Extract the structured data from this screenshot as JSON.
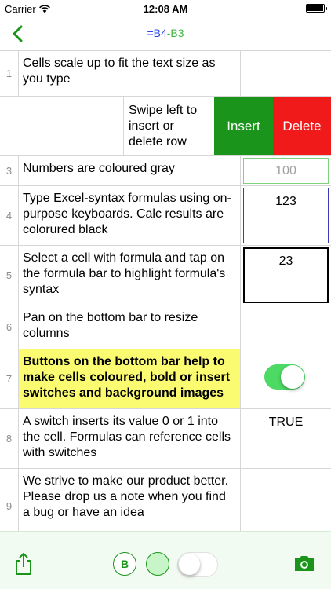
{
  "status_bar": {
    "carrier": "Carrier",
    "time": "12:08 AM"
  },
  "formula_bar": {
    "prefix": "=",
    "ref_a": "B4",
    "operator": "-",
    "ref_b": "B3"
  },
  "rows": {
    "r1": {
      "num": "1",
      "text": "Cells scale up to fit the text size as you type",
      "value": ""
    },
    "r2": {
      "text": "Swipe left to insert or delete row",
      "insert_label": "Insert",
      "delete_label": "Delete"
    },
    "r3": {
      "num": "3",
      "text": "Numbers are coloured gray",
      "value": "100"
    },
    "r4": {
      "num": "4",
      "text": "Type Excel-syntax formulas using on-purpose keyboards. Calc results are colorured black",
      "value": "123"
    },
    "r5": {
      "num": "5",
      "text": "Select a cell with formula and tap on the formula bar to highlight formula's syntax",
      "value": "23"
    },
    "r6": {
      "num": "6",
      "text": "Pan on the bottom bar to resize columns",
      "value": ""
    },
    "r7": {
      "num": "7",
      "text": "Buttons on the bottom bar help to make cells coloured, bold or insert switches and background images",
      "switch_on": true
    },
    "r8": {
      "num": "8",
      "text": "A switch inserts its value 0 or 1 into the cell. Formulas can reference cells with switches",
      "value": "TRUE"
    },
    "r9": {
      "num": "9",
      "text": "We strive to make our product better.\nPlease drop us a note when you find a bug or have an idea",
      "value": ""
    }
  },
  "toolbar": {
    "bold_label": "B",
    "switch_on": false
  },
  "colors": {
    "accent_green": "#1a941a",
    "insert_green": "#1a941a",
    "delete_red": "#f11a1a",
    "highlight_yellow": "#fbfb72",
    "switch_green": "#4cd964"
  }
}
